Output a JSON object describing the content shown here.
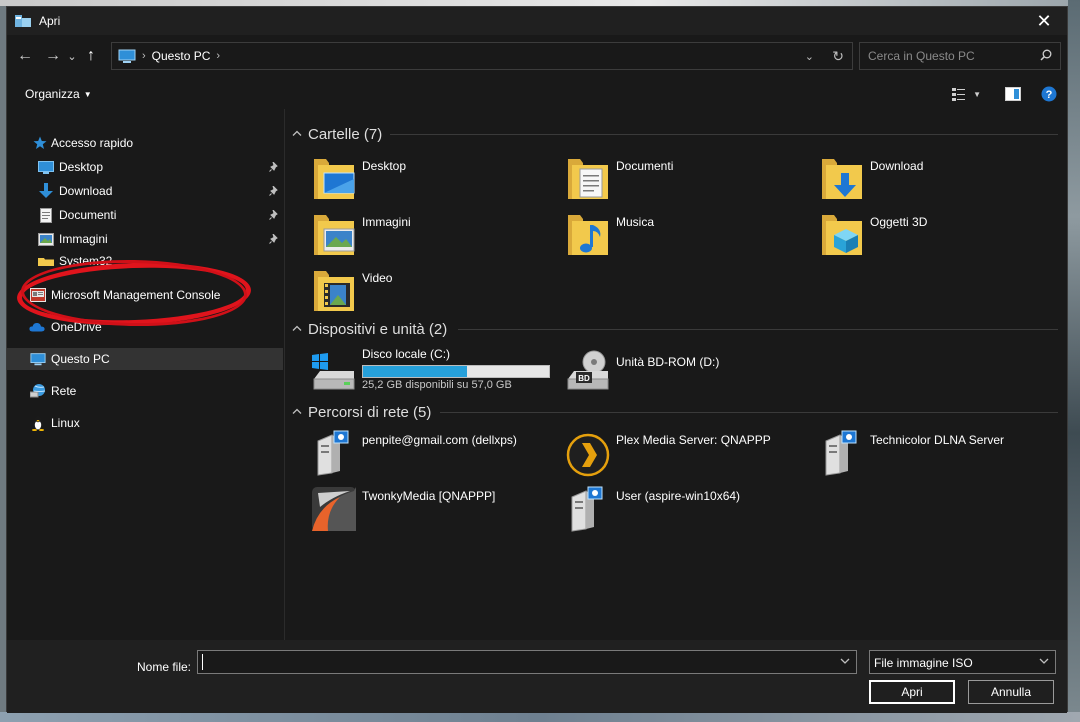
{
  "window": {
    "title": "Apri",
    "close_glyph": "✕"
  },
  "nav": {
    "back": "←",
    "forward": "→",
    "recent": "⌄",
    "up": "↑",
    "breadcrumb": [
      "Questo PC"
    ],
    "sep": "›",
    "refresh": "↻",
    "search_placeholder": "Cerca in Questo PC"
  },
  "toolbar": {
    "organize_label": "Organizza",
    "caret": "▼"
  },
  "sidebar": {
    "items": [
      {
        "label": "Accesso rapido",
        "icon": "star-icon",
        "pinned": false
      },
      {
        "label": "Desktop",
        "icon": "desktop-icon",
        "pinned": true
      },
      {
        "label": "Download",
        "icon": "download-icon",
        "pinned": true
      },
      {
        "label": "Documenti",
        "icon": "documents-icon",
        "pinned": true
      },
      {
        "label": "Immagini",
        "icon": "pictures-icon",
        "pinned": true
      },
      {
        "label": "System32",
        "icon": "folder-icon",
        "pinned": false
      },
      {
        "label": "Microsoft Management Console",
        "icon": "mmc-icon",
        "pinned": false
      },
      {
        "label": "OneDrive",
        "icon": "cloud-icon",
        "pinned": false
      },
      {
        "label": "Questo PC",
        "icon": "computer-icon",
        "pinned": false
      },
      {
        "label": "Rete",
        "icon": "network-icon",
        "pinned": false
      },
      {
        "label": "Linux",
        "icon": "linux-icon",
        "pinned": false
      }
    ],
    "pin_glyph": "📌"
  },
  "content": {
    "groups": [
      {
        "title": "Cartelle (7)",
        "items": [
          {
            "name": "Desktop",
            "icon": "folder-desktop-icon"
          },
          {
            "name": "Documenti",
            "icon": "folder-documents-icon"
          },
          {
            "name": "Download",
            "icon": "folder-download-icon"
          },
          {
            "name": "Immagini",
            "icon": "folder-pictures-icon"
          },
          {
            "name": "Musica",
            "icon": "folder-music-icon"
          },
          {
            "name": "Oggetti 3D",
            "icon": "folder-3d-icon"
          },
          {
            "name": "Video",
            "icon": "folder-video-icon"
          }
        ]
      },
      {
        "title": "Dispositivi e unità (2)",
        "items": [
          {
            "name": "Disco locale (C:)",
            "sub": "25,2 GB disponibili su 57,0 GB",
            "icon": "drive-c-icon",
            "used_fraction": 0.558
          },
          {
            "name": "Unità BD-ROM (D:)",
            "icon": "bd-rom-icon",
            "badge": "BD"
          }
        ]
      },
      {
        "title": "Percorsi di rete (5)",
        "items": [
          {
            "name": "penpite@gmail.com (dellxps)",
            "icon": "media-server-icon"
          },
          {
            "name": "Plex Media Server: QNAPPP",
            "icon": "plex-icon"
          },
          {
            "name": "Technicolor DLNA Server",
            "icon": "media-server-icon"
          },
          {
            "name": "TwonkyMedia [QNAPPP]",
            "icon": "twonky-icon"
          },
          {
            "name": "User (aspire-win10x64)",
            "icon": "media-server-icon"
          }
        ]
      }
    ]
  },
  "footer": {
    "filename_label": "Nome file:",
    "filename_value": "",
    "filetype_value": "File immagine ISO",
    "open_label": "Apri",
    "cancel_label": "Annulla"
  },
  "colors": {
    "accent": "#26a0da",
    "folder": "#f2c94c",
    "annotation": "#e0141c"
  }
}
